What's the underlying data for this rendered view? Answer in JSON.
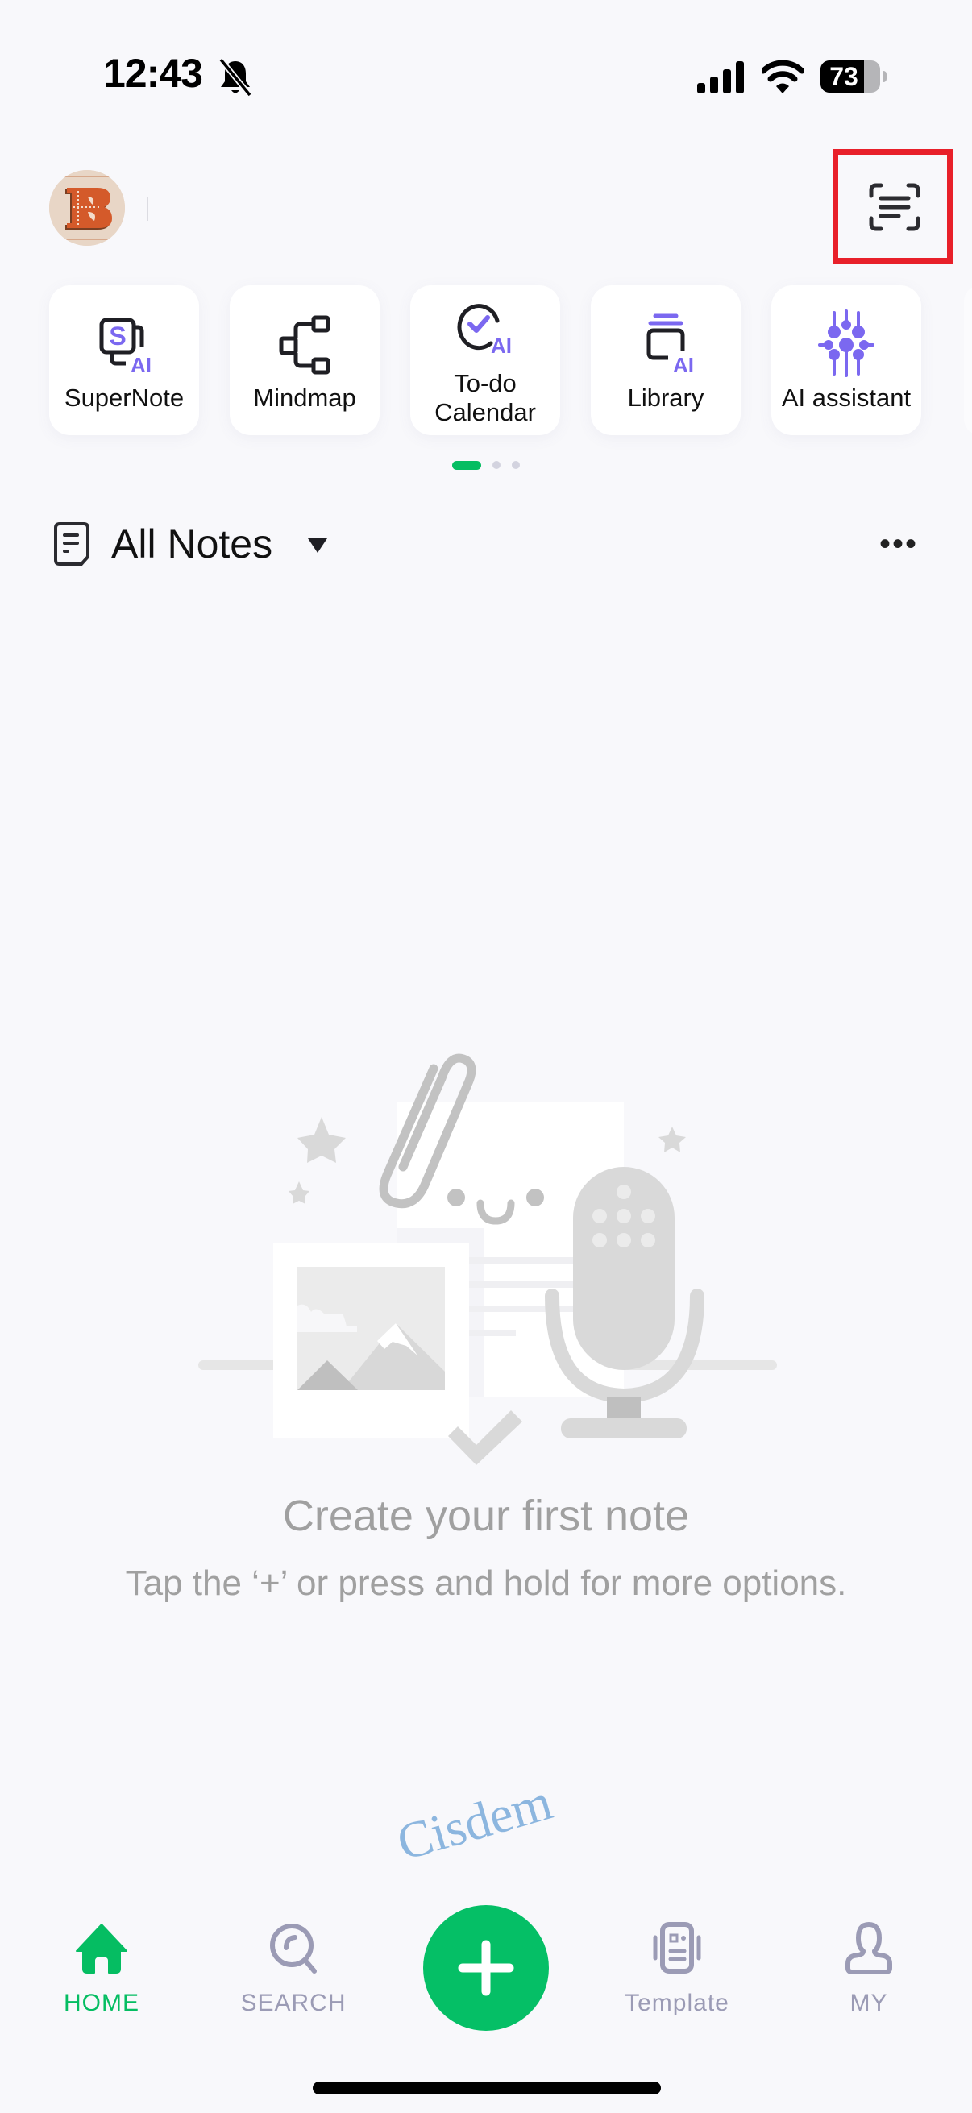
{
  "status_bar": {
    "time": "12:43",
    "silent_icon": "bell-slash-icon",
    "signal_icon": "cellular-signal-icon",
    "wifi_icon": "wifi-icon",
    "battery_percent": 73
  },
  "header": {
    "avatar_letter": "B",
    "scan_icon": "scan-text-icon"
  },
  "feature_cards": [
    {
      "label": "SuperNote",
      "icon": "supernote-ai-icon"
    },
    {
      "label": "Mindmap",
      "icon": "mindmap-icon"
    },
    {
      "label": "To-do\nCalendar",
      "label_line1": "To-do",
      "label_line2": "Calendar",
      "icon": "todo-check-ai-icon"
    },
    {
      "label": "Library",
      "icon": "library-ai-icon"
    },
    {
      "label": "AI assistant",
      "icon": "ai-assistant-icon"
    }
  ],
  "pager": {
    "pages": 3,
    "current": 1
  },
  "notes_section": {
    "title": "All Notes",
    "icon": "notes-document-icon",
    "dropdown_icon": "caret-down-icon",
    "more_label": "•••"
  },
  "empty_state": {
    "title": "Create your first note",
    "subtitle": "Tap the ‘+’ or press and hold for more options."
  },
  "watermark": "Cisdem",
  "bottom_nav": {
    "items": [
      {
        "label": "HOME",
        "icon": "home-icon",
        "active": true
      },
      {
        "label": "SEARCH",
        "icon": "search-icon",
        "active": false
      },
      {
        "label": "Template",
        "icon": "template-icon",
        "active": false
      },
      {
        "label": "MY",
        "icon": "profile-icon",
        "active": false
      }
    ],
    "add_icon": "plus-icon"
  },
  "colors": {
    "accent_green": "#05bd62",
    "ai_purple": "#7b68f0",
    "inactive_nav": "#9b9bb5",
    "highlight_red": "#e8202a",
    "background": "#f8f8fb"
  }
}
